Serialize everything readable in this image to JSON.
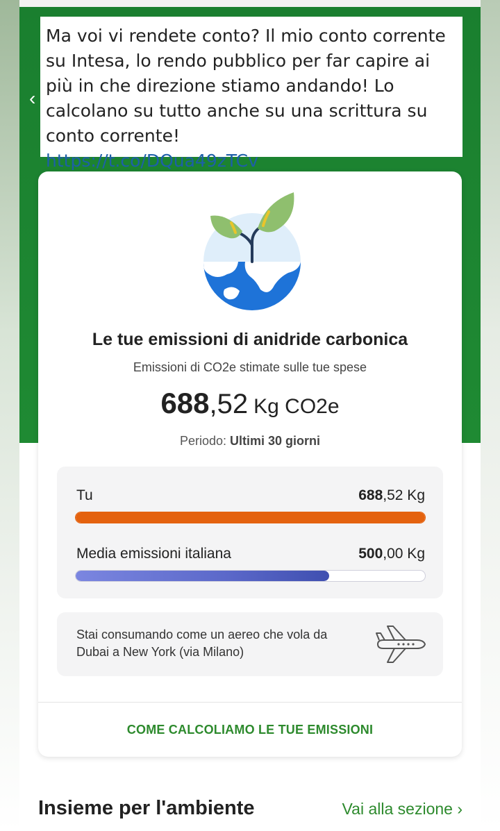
{
  "tweet": {
    "text": "Ma voi vi rendete conto? Il mio conto corrente su Intesa, lo rendo pubblico per far capire ai più in che direzione stiamo andando! Lo calcolano su tutto anche su una scrittura su conto corrente!",
    "link": "https://t.co/DQua49zTCv"
  },
  "card": {
    "title": "Le tue emissioni di anidride carbonica",
    "subtitle": "Emissioni di CO2e stimate sulle tue spese",
    "total_int": "688",
    "total_dec": ",52",
    "total_unit": "Kg CO2e",
    "period_label": "Periodo:",
    "period_value": "Ultimi 30 giorni"
  },
  "comparison": {
    "you": {
      "label": "Tu",
      "value_int": "688",
      "value_dec": ",52 Kg",
      "fill_fraction": 1.0,
      "color": "#e4620f"
    },
    "italy_avg": {
      "label": "Media emissioni italiana",
      "value_int": "500",
      "value_dec": ",00 Kg",
      "fill_fraction": 0.726,
      "color": "#5b68c9"
    }
  },
  "info": {
    "text": "Stai consumando come un aereo che vola da Dubai a New York (via Milano)",
    "icon": "airplane-icon"
  },
  "cta": {
    "label": "COME CALCOLIAMO LE TUE EMISSIONI"
  },
  "section": {
    "title": "Insieme per l'ambiente",
    "link": "Vai alla sezione ›"
  },
  "colors": {
    "brand_green": "#1f8a33",
    "link_green": "#2d8a2d"
  }
}
